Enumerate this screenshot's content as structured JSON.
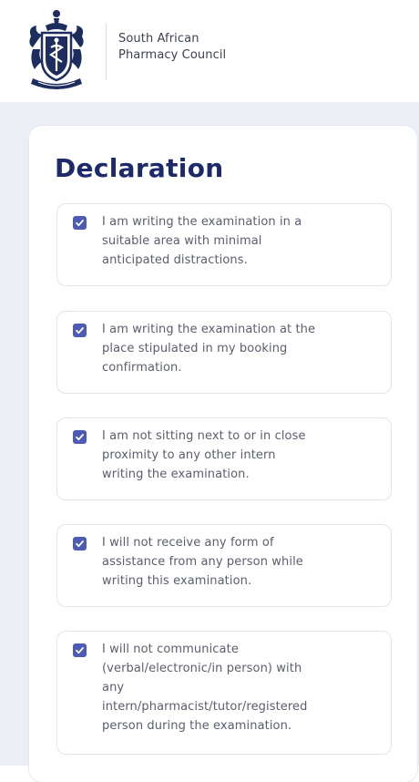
{
  "header": {
    "org_name_line1": "South African",
    "org_name_line2": "Pharmacy Council"
  },
  "declaration": {
    "title": "Declaration",
    "items": [
      {
        "checked": true,
        "lines": [
          "I am writing the examination in a",
          "suitable area with minimal",
          "anticipated distractions."
        ]
      },
      {
        "checked": true,
        "lines": [
          "I am writing the examination at the",
          "place stipulated in my booking",
          "confirmation."
        ]
      },
      {
        "checked": true,
        "lines": [
          "I am not sitting next to or in close",
          "proximity to any other intern",
          "writing the examination."
        ]
      },
      {
        "checked": true,
        "lines": [
          "I will not receive any form of",
          "assistance from any person while",
          "writing this examination."
        ]
      },
      {
        "checked": true,
        "lines": [
          "I will not communicate",
          "(verbal/electronic/in person) with",
          "any",
          "intern/pharmacist/tutor/registered",
          "person during the examination."
        ]
      }
    ]
  },
  "colors": {
    "title": "#1c2a6b",
    "checkbox": "#4d5bb5",
    "page_background": "#eceef5"
  }
}
